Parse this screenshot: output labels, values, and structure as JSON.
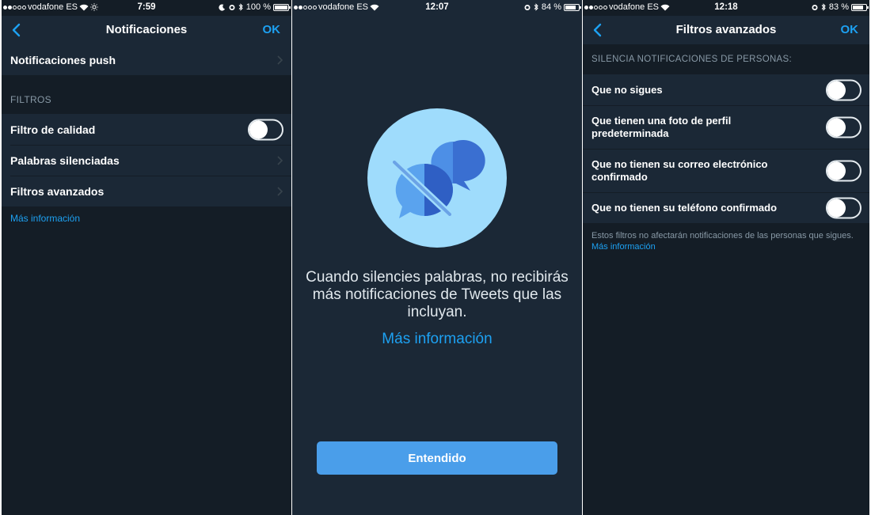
{
  "colors": {
    "background": "#141d26",
    "cell": "#1b2836",
    "accent": "#1da1f2",
    "button": "#4a9eea",
    "muted_text": "#8899a6",
    "illustration_circle": "#9fdcfc"
  },
  "screen1": {
    "status": {
      "carrier": "vodafone ES",
      "time": "7:59",
      "battery": "100 %",
      "battery_level": 1.0
    },
    "nav": {
      "back_icon": "chevron-left-icon",
      "title": "Notificaciones",
      "ok": "OK"
    },
    "push_row": {
      "label": "Notificaciones push"
    },
    "section": {
      "label": "FILTROS"
    },
    "rows": [
      {
        "label": "Filtro de calidad",
        "control": "toggle",
        "on": false
      },
      {
        "label": "Palabras silenciadas",
        "control": "chevron"
      },
      {
        "label": "Filtros avanzados",
        "control": "chevron"
      }
    ],
    "more_info": "Más información"
  },
  "screen2": {
    "status": {
      "carrier": "vodafone ES",
      "time": "12:07",
      "battery": "84 %",
      "battery_level": 0.84
    },
    "illustration": "muted-conversation-icon",
    "message": "Cuando silencies palabras, no recibirás más notificaciones de Tweets que las incluyan.",
    "more_info": "Más información",
    "button": "Entendido"
  },
  "screen3": {
    "status": {
      "carrier": "vodafone ES",
      "time": "12:18",
      "battery": "83 %",
      "battery_level": 0.83
    },
    "nav": {
      "back_icon": "chevron-left-icon",
      "title": "Filtros avanzados",
      "ok": "OK"
    },
    "section": {
      "label": "SILENCIA NOTIFICACIONES DE PERSONAS:"
    },
    "rows": [
      {
        "label": "Que no sigues",
        "on": false
      },
      {
        "label": "Que tienen una foto de perfil predeterminada",
        "on": false
      },
      {
        "label": "Que no tienen su correo electrónico confirmado",
        "on": false
      },
      {
        "label": "Que no tienen su teléfono confirmado",
        "on": false
      }
    ],
    "footer": "Estos filtros no afectarán notificaciones de las personas que sigues.",
    "footer_link": "Más información"
  }
}
